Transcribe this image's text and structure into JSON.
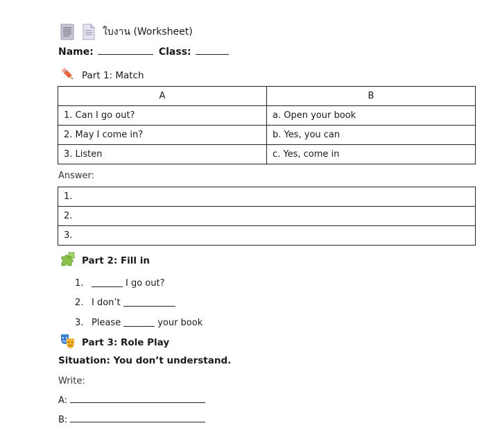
{
  "header": {
    "doc_icon": "document-icon",
    "file_icon": "file-icon",
    "title": "ใบงาน (Worksheet)"
  },
  "student": {
    "name_label": "Name:",
    "class_label": "Class:"
  },
  "part1": {
    "icon": "pencil-icon",
    "heading": "Part 1: Match",
    "columns": [
      "A",
      "B"
    ],
    "rows": [
      [
        "1. Can I go out?",
        "a. Open your book"
      ],
      [
        "2. May I come in?",
        "b. Yes, you can"
      ],
      [
        "3. Listen",
        "c. Yes, come in"
      ]
    ],
    "answer_label": "Answer:",
    "answers": [
      "1.",
      "2.",
      "3."
    ]
  },
  "part2": {
    "icon": "puzzle-icon",
    "heading": "Part 2: Fill in",
    "items": [
      {
        "num": "1.",
        "before": "",
        "after": "I go out?"
      },
      {
        "num": "2.",
        "before": "I don’t",
        "after": ""
      },
      {
        "num": "3.",
        "before": "Please",
        "after": "your book"
      }
    ]
  },
  "part3": {
    "icon": "theater-masks-icon",
    "heading": "Part 3: Role Play",
    "situation": "Situation: You don’t understand.",
    "write_label": "Write:",
    "lines": [
      "A:",
      "B:"
    ]
  },
  "colors": {
    "text": "#1a1a1a",
    "border": "#222222",
    "pencil": "#e8623a",
    "puzzle": "#8bc34a",
    "mask_blue": "#3b7fd1",
    "mask_yellow": "#f2b632"
  }
}
